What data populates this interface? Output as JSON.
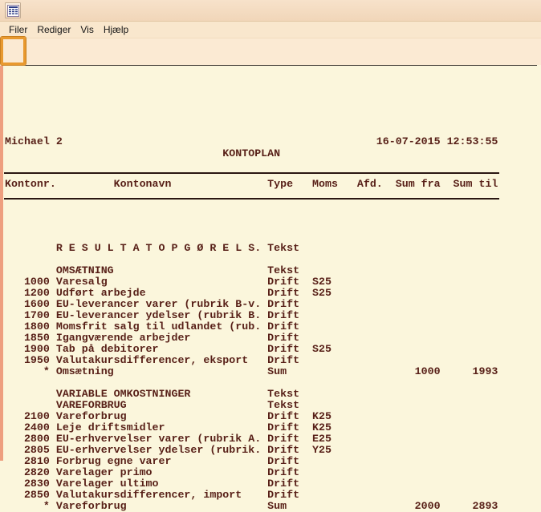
{
  "window": {
    "app_icon": "table-icon"
  },
  "menu": {
    "items": [
      {
        "label": "Filer"
      },
      {
        "label": "Rediger"
      },
      {
        "label": "Vis"
      },
      {
        "label": "Hjælp"
      }
    ]
  },
  "toolbar": {
    "buttons": [
      {
        "name": "save",
        "icon": "save-icon",
        "highlighted": true
      },
      {
        "name": "print",
        "icon": "printer-icon",
        "highlighted": false
      },
      {
        "name": "page-break",
        "icon": "page-break-icon",
        "highlighted": false
      }
    ],
    "highlight_color": "#E8992F"
  },
  "report": {
    "user": "Michael 2",
    "timestamp": "16-07-2015 12:53:55",
    "title": "KONTOPLAN",
    "columns": [
      "Kontonr.",
      "Kontonavn",
      "Type",
      "Moms",
      "Afd.",
      "Sum fra",
      "Sum til"
    ],
    "rows": [
      {
        "kontonavn": "R E S U L T A T O P G Ø R E L S.",
        "type": "Tekst"
      },
      null,
      {
        "kontonavn": "OMSÆTNING",
        "type": "Tekst"
      },
      {
        "kontonr": "1000",
        "kontonavn": "Varesalg",
        "type": "Drift",
        "moms": "S25"
      },
      {
        "kontonr": "1200",
        "kontonavn": "Udført arbejde",
        "type": "Drift",
        "moms": "S25"
      },
      {
        "kontonr": "1600",
        "kontonavn": "EU-leverancer varer (rubrik B-v.",
        "type": "Drift"
      },
      {
        "kontonr": "1700",
        "kontonavn": "EU-leverancer ydelser (rubrik B.",
        "type": "Drift"
      },
      {
        "kontonr": "1800",
        "kontonavn": "Momsfrit salg til udlandet (rub.",
        "type": "Drift"
      },
      {
        "kontonr": "1850",
        "kontonavn": "Igangværende arbejder",
        "type": "Drift"
      },
      {
        "kontonr": "1900",
        "kontonavn": "Tab på debitorer",
        "type": "Drift",
        "moms": "S25"
      },
      {
        "kontonr": "1950",
        "kontonavn": "Valutakursdifferencer, eksport",
        "type": "Drift"
      },
      {
        "kontonr": "*",
        "kontonavn": "Omsætning",
        "type": "Sum",
        "sum_fra": "1000",
        "sum_til": "1993"
      },
      null,
      {
        "kontonavn": "VARIABLE OMKOSTNINGER",
        "type": "Tekst"
      },
      {
        "kontonavn": "VAREFORBRUG",
        "type": "Tekst"
      },
      {
        "kontonr": "2100",
        "kontonavn": "Vareforbrug",
        "type": "Drift",
        "moms": "K25"
      },
      {
        "kontonr": "2400",
        "kontonavn": "Leje driftsmidler",
        "type": "Drift",
        "moms": "K25"
      },
      {
        "kontonr": "2800",
        "kontonavn": "EU-erhvervelser varer (rubrik A.",
        "type": "Drift",
        "moms": "E25"
      },
      {
        "kontonr": "2805",
        "kontonavn": "EU-erhvervelser ydelser (rubrik.",
        "type": "Drift",
        "moms": "Y25"
      },
      {
        "kontonr": "2810",
        "kontonavn": "Forbrug egne varer",
        "type": "Drift"
      },
      {
        "kontonr": "2820",
        "kontonavn": "Varelager primo",
        "type": "Drift"
      },
      {
        "kontonr": "2830",
        "kontonavn": "Varelager ultimo",
        "type": "Drift"
      },
      {
        "kontonr": "2850",
        "kontonavn": "Valutakursdifferencer, import",
        "type": "Drift"
      },
      {
        "kontonr": "*",
        "kontonavn": "Vareforbrug",
        "type": "Sum",
        "sum_fra": "2000",
        "sum_til": "2893"
      }
    ]
  },
  "colors": {
    "accent_orange": "#E8992F",
    "report_text": "#571F17",
    "report_bg": "#FBF6DC",
    "chrome_bg": "#F6DFC5",
    "left_strip": "#EE9F7F"
  }
}
